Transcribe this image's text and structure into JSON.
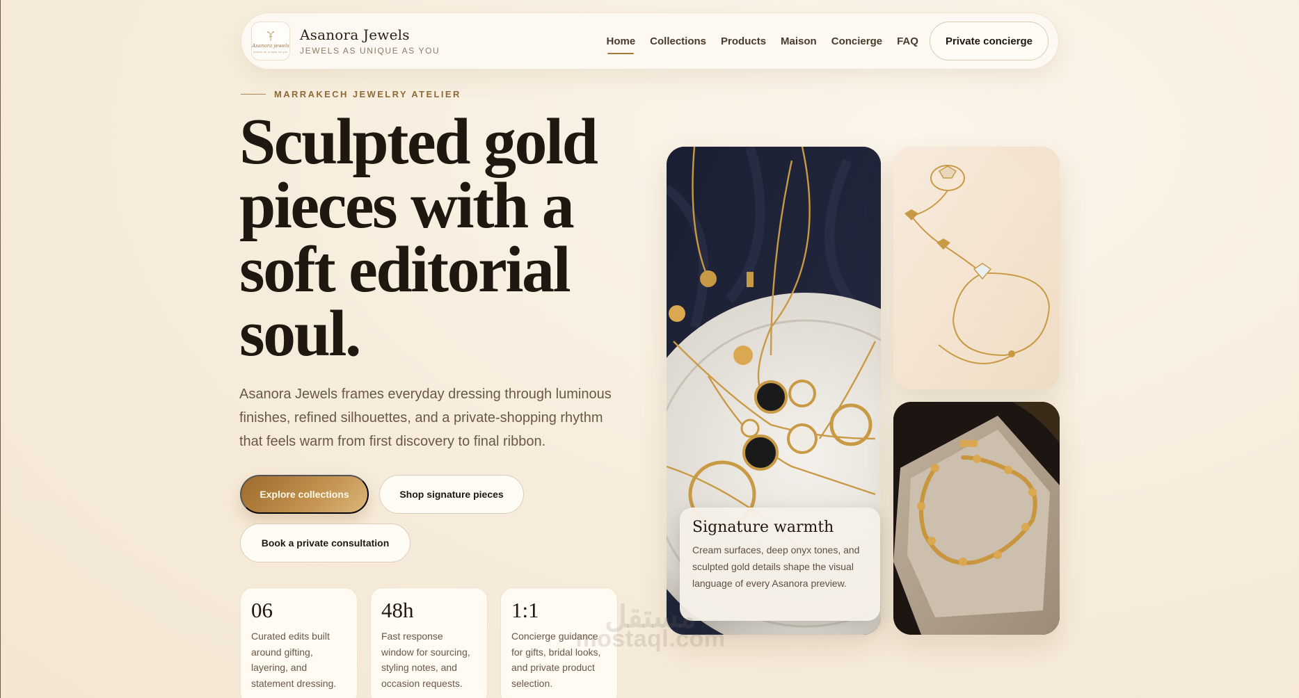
{
  "nav": {
    "brand_name": "Asanora Jewels",
    "brand_tagline": "JEWELS AS UNIQUE AS YOU",
    "logo_script": "Asanora jewels",
    "logo_tiny": "jewels as unique as you",
    "links": [
      "Home",
      "Collections",
      "Products",
      "Maison",
      "Concierge",
      "FAQ"
    ],
    "active_link": "Home",
    "cta": "Private concierge"
  },
  "hero": {
    "eyebrow": "MARRAKECH JEWELRY ATELIER",
    "headline": "Sculpted gold pieces with a soft editorial soul.",
    "lede": "Asanora Jewels frames everyday dressing through luminous finishes, refined silhouettes, and a private-shopping rhythm that feels warm from first discovery to final ribbon.",
    "buttons": {
      "primary": "Explore collections",
      "shop": "Shop signature pieces",
      "book": "Book a private consultation"
    }
  },
  "stats": [
    {
      "value": "06",
      "text": "Curated edits built around gifting, layering, and statement dressing."
    },
    {
      "value": "48h",
      "text": "Fast response window for sourcing, styling notes, and occasion requests."
    },
    {
      "value": "1:1",
      "text": "Concierge guidance for gifts, bridal looks, and private product selection."
    }
  ],
  "feature_card": {
    "title": "Signature warmth",
    "text": "Cream surfaces, deep onyx tones, and sculpted gold details shape the visual language of every Asanora preview."
  },
  "watermark": {
    "arabic": "مستقل",
    "latin": "mostaql.com"
  },
  "colors": {
    "accent_gold": "#b0803e",
    "background_cream": "#f7eddd",
    "ink": "#1f1710"
  }
}
